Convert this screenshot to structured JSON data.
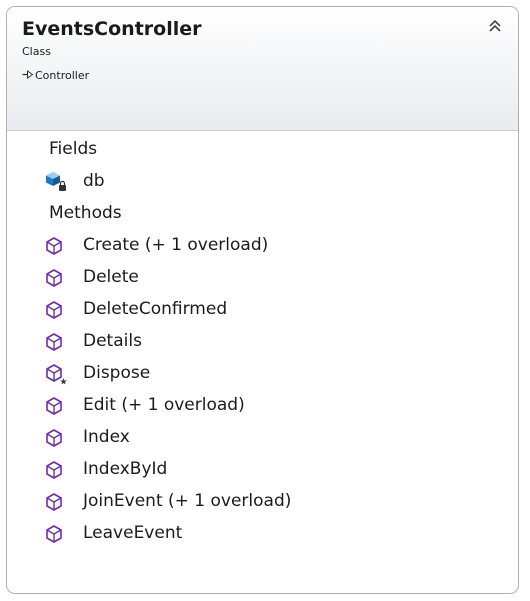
{
  "class_shape": {
    "title": "EventsController",
    "stereotype": "Class",
    "base_type": "Controller",
    "icons": {
      "base_arrow": "inheritance-arrow-icon",
      "collapse": "double-chevron-up-icon"
    }
  },
  "fields_section": {
    "label": "Fields",
    "items": [
      {
        "name": "db",
        "icon": "private-field-icon"
      }
    ]
  },
  "methods_section": {
    "label": "Methods",
    "items": [
      {
        "name": "Create (+ 1 overload)",
        "icon": "public-method-icon"
      },
      {
        "name": "Delete",
        "icon": "public-method-icon"
      },
      {
        "name": "DeleteConfirmed",
        "icon": "public-method-icon"
      },
      {
        "name": "Details",
        "icon": "public-method-icon"
      },
      {
        "name": "Dispose",
        "icon": "protected-method-icon"
      },
      {
        "name": "Edit (+ 1 overload)",
        "icon": "public-method-icon"
      },
      {
        "name": "Index",
        "icon": "public-method-icon"
      },
      {
        "name": "IndexById",
        "icon": "public-method-icon"
      },
      {
        "name": "JoinEvent (+ 1 overload)",
        "icon": "public-method-icon"
      },
      {
        "name": "LeaveEvent",
        "icon": "public-method-icon"
      }
    ]
  },
  "colors": {
    "method_icon": "#6b2fa3",
    "field_icon": "#1e79c4",
    "border": "#b2b2b2"
  }
}
